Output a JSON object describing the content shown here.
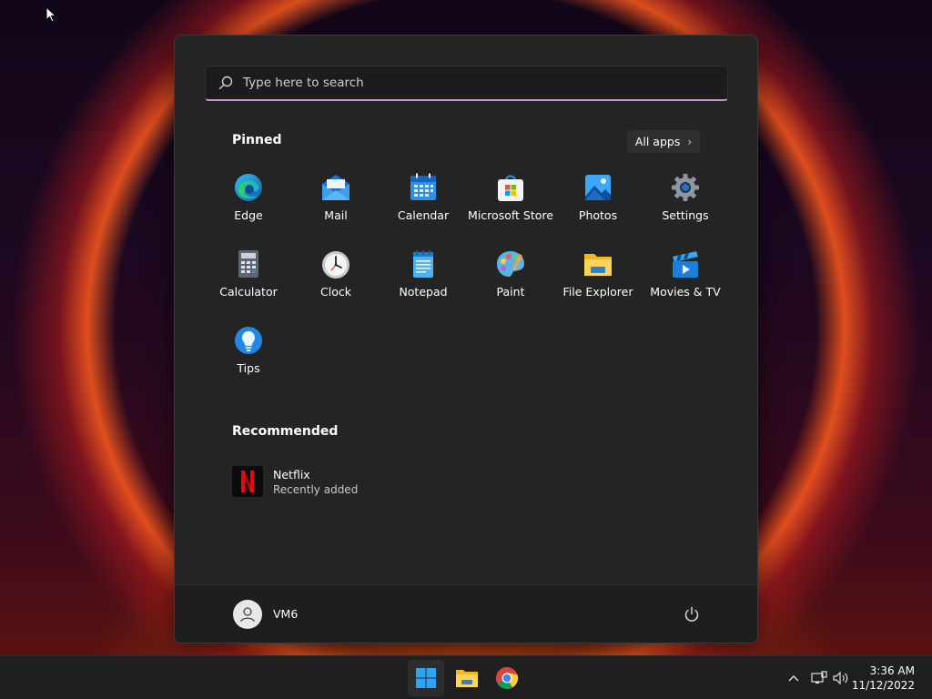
{
  "search": {
    "placeholder": "Type here to search"
  },
  "pinned": {
    "title": "Pinned",
    "all_apps_label": "All apps",
    "apps": [
      {
        "label": "Edge",
        "icon": "edge-icon"
      },
      {
        "label": "Mail",
        "icon": "mail-icon"
      },
      {
        "label": "Calendar",
        "icon": "calendar-icon"
      },
      {
        "label": "Microsoft Store",
        "icon": "microsoft-store-icon"
      },
      {
        "label": "Photos",
        "icon": "photos-icon"
      },
      {
        "label": "Settings",
        "icon": "settings-icon"
      },
      {
        "label": "Calculator",
        "icon": "calculator-icon"
      },
      {
        "label": "Clock",
        "icon": "clock-icon"
      },
      {
        "label": "Notepad",
        "icon": "notepad-icon"
      },
      {
        "label": "Paint",
        "icon": "paint-icon"
      },
      {
        "label": "File Explorer",
        "icon": "file-explorer-icon"
      },
      {
        "label": "Movies & TV",
        "icon": "movies-tv-icon"
      },
      {
        "label": "Tips",
        "icon": "tips-icon"
      }
    ]
  },
  "recommended": {
    "title": "Recommended",
    "items": [
      {
        "name": "Netflix",
        "subtitle": "Recently added",
        "icon": "netflix-icon"
      }
    ]
  },
  "user": {
    "name": "VM6"
  },
  "taskbar": {
    "time": "3:36 AM",
    "date": "11/12/2022"
  },
  "colors": {
    "menu_bg": "#242424",
    "search_accent": "#c98fd6",
    "taskbar_bg": "#1f1f1f"
  }
}
